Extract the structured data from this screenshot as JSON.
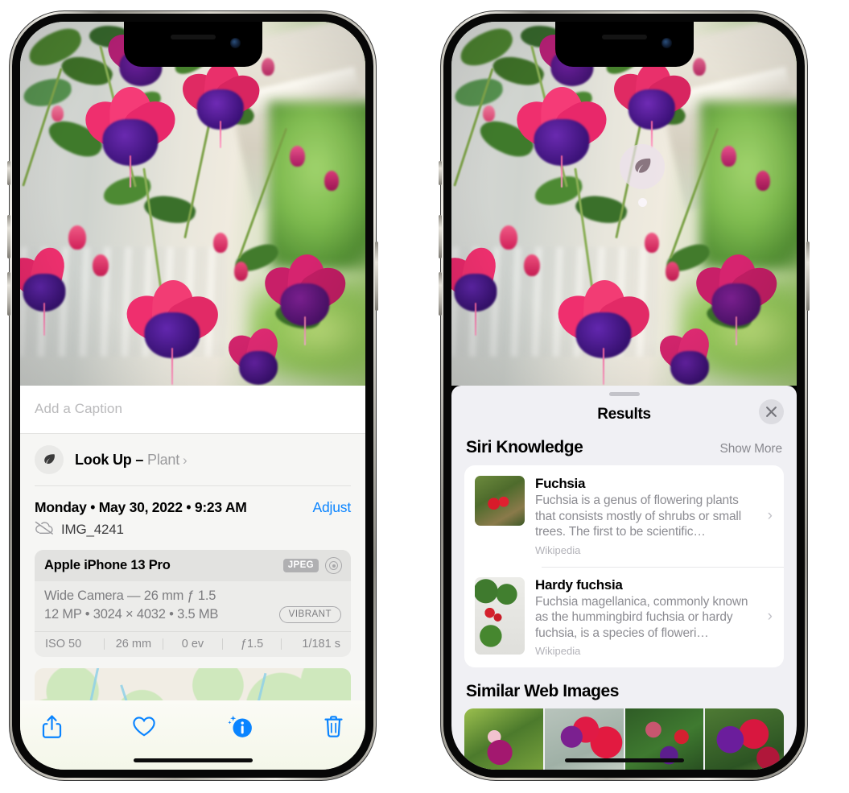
{
  "left_phone": {
    "caption_placeholder": "Add a Caption",
    "lookup": {
      "icon": "leaf-icon",
      "label": "Look Up – ",
      "subject": "Plant",
      "chevron": "›"
    },
    "date_line": "Monday • May 30, 2022 • 9:23 AM",
    "adjust_label": "Adjust",
    "file_name": "IMG_4241",
    "cloud_icon": "cloud-slash-icon",
    "camera_card": {
      "device": "Apple iPhone 13 Pro",
      "format_badge": "JPEG",
      "aperture_icon": "aperture-icon",
      "lens": "Wide Camera — 26 mm ƒ 1.5",
      "dimensions": "12 MP • 3024 × 4032 • 3.5 MB",
      "style_badge": "VIBRANT",
      "exif": [
        "ISO 50",
        "26 mm",
        "0 ev",
        "ƒ1.5",
        "1/181 s"
      ]
    },
    "toolbar": [
      {
        "name": "share-icon",
        "label": "Share"
      },
      {
        "name": "heart-icon",
        "label": "Favorite"
      },
      {
        "name": "info-icon",
        "label": "Info"
      },
      {
        "name": "trash-icon",
        "label": "Delete"
      }
    ]
  },
  "right_phone": {
    "badge_icon": "leaf-icon",
    "sheet_title": "Results",
    "close_icon": "close-icon",
    "siri_section": {
      "title": "Siri Knowledge",
      "action": "Show More",
      "items": [
        {
          "title": "Fuchsia",
          "description": "Fuchsia is a genus of flowering plants that consists mostly of shrubs or small trees. The first to be scientific…",
          "source": "Wikipedia",
          "chevron": "›"
        },
        {
          "title": "Hardy fuchsia",
          "description": "Fuchsia magellanica, commonly known as the hummingbird fuchsia or hardy fuchsia, is a species of floweri…",
          "source": "Wikipedia",
          "chevron": "›"
        }
      ]
    },
    "similar_section": {
      "title": "Similar Web Images",
      "thumbnails": [
        "fuchsia-web-image-1",
        "fuchsia-web-image-2",
        "fuchsia-web-image-3",
        "fuchsia-web-image-4"
      ]
    }
  },
  "colors": {
    "accent_blue": "#0a84ff",
    "sheet_bg": "#f6f6f4",
    "results_bg": "#f0f0f4",
    "card_bg": "#ececea",
    "muted_text": "#8c8c92"
  }
}
